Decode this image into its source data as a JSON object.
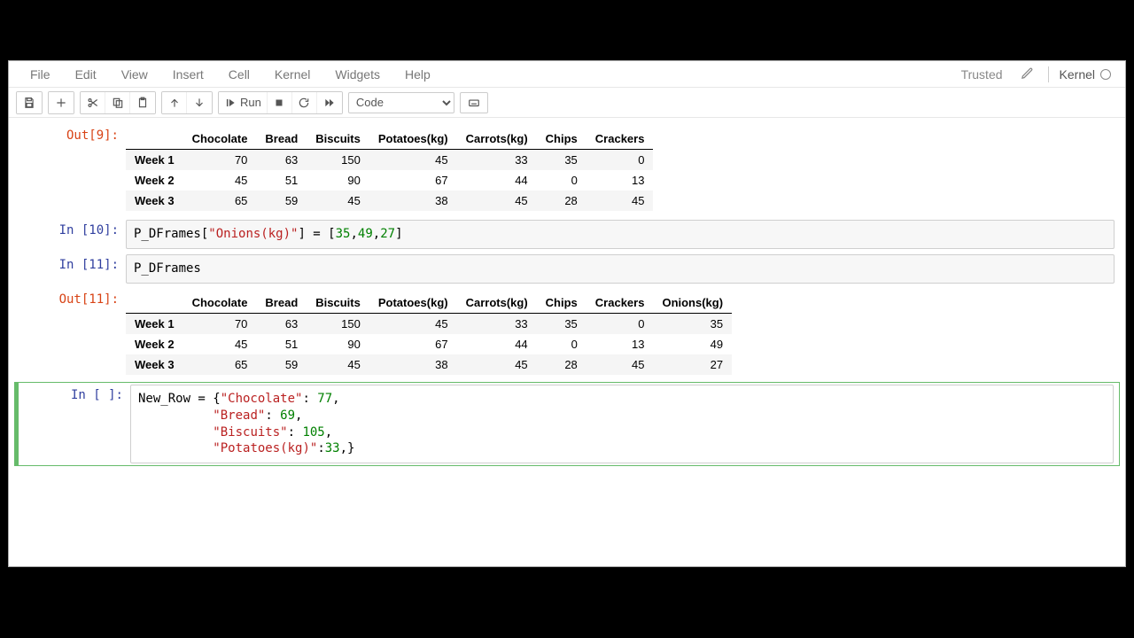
{
  "menu": {
    "file": "File",
    "edit": "Edit",
    "view": "View",
    "insert": "Insert",
    "cell": "Cell",
    "kernel": "Kernel",
    "widgets": "Widgets",
    "help": "Help"
  },
  "header": {
    "trusted": "Trusted",
    "kernel": "Kernel"
  },
  "toolbar": {
    "run_label": "Run",
    "celltype": "Code"
  },
  "cells": {
    "out9_label": "Out[9]:",
    "in10_label": "In [10]:",
    "in11_label": "In [11]:",
    "out11_label": "Out[11]:",
    "in_empty_label": "In [ ]:",
    "code10": {
      "p1": "P_DFrames[",
      "s1": "\"Onions(kg)\"",
      "p2": "] = [",
      "n1": "35",
      "c1": ",",
      "n2": "49",
      "c2": ",",
      "n3": "27",
      "p3": "]"
    },
    "code11": "P_DFrames",
    "codeNew": {
      "l1a": "New_Row = {",
      "l1s": "\"Chocolate\"",
      "l1b": ": ",
      "l1n": "77",
      "l1c": ",",
      "pad1": "          ",
      "l2s": "\"Bread\"",
      "l2b": ": ",
      "l2n": "69",
      "l2c": ",",
      "pad2": "          ",
      "l3s": "\"Biscuits\"",
      "l3b": ": ",
      "l3n": "105",
      "l3c": ",",
      "pad3": "          ",
      "l4s": "\"Potatoes(kg)\"",
      "l4b": ":",
      "l4n": "33",
      "l4c": ",}"
    }
  },
  "table9": {
    "columns": [
      "",
      "Chocolate",
      "Bread",
      "Biscuits",
      "Potatoes(kg)",
      "Carrots(kg)",
      "Chips",
      "Crackers"
    ],
    "rows": [
      {
        "label": "Week 1",
        "v": [
          "70",
          "63",
          "150",
          "45",
          "33",
          "35",
          "0"
        ]
      },
      {
        "label": "Week 2",
        "v": [
          "45",
          "51",
          "90",
          "67",
          "44",
          "0",
          "13"
        ]
      },
      {
        "label": "Week 3",
        "v": [
          "65",
          "59",
          "45",
          "38",
          "45",
          "28",
          "45"
        ]
      }
    ]
  },
  "table11": {
    "columns": [
      "",
      "Chocolate",
      "Bread",
      "Biscuits",
      "Potatoes(kg)",
      "Carrots(kg)",
      "Chips",
      "Crackers",
      "Onions(kg)"
    ],
    "rows": [
      {
        "label": "Week 1",
        "v": [
          "70",
          "63",
          "150",
          "45",
          "33",
          "35",
          "0",
          "35"
        ]
      },
      {
        "label": "Week 2",
        "v": [
          "45",
          "51",
          "90",
          "67",
          "44",
          "0",
          "13",
          "49"
        ]
      },
      {
        "label": "Week 3",
        "v": [
          "65",
          "59",
          "45",
          "38",
          "45",
          "28",
          "45",
          "27"
        ]
      }
    ]
  }
}
